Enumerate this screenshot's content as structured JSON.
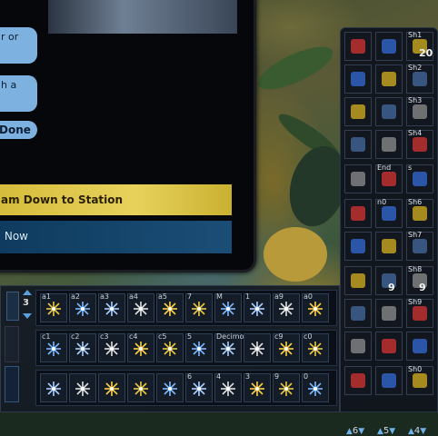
{
  "dialog": {
    "options": [
      "r or",
      "h a",
      "Done"
    ],
    "primary_action": "am Down to Station",
    "secondary_action": ": Now"
  },
  "tray": {
    "row_labels": [
      "3"
    ],
    "rows": [
      [
        "a1",
        "a2",
        "a3",
        "a4",
        "a5",
        "7",
        "M",
        "1",
        "a9",
        "a0"
      ],
      [
        "c1",
        "c2",
        "c3",
        "c4",
        "c5",
        "5",
        "Decimo2",
        "",
        "c9",
        "c0"
      ],
      [
        "",
        "",
        "",
        "",
        "",
        "6",
        "4",
        "3",
        "9",
        "0"
      ]
    ]
  },
  "right_bar": {
    "slot_labels": [
      "Sh1",
      "Sh2",
      "Sh3",
      "Sh4",
      "End",
      "s",
      "n0",
      "Sh6",
      "Sh7",
      "Sh8",
      "Sh9",
      "Sh0"
    ],
    "counts": [
      "20",
      "9",
      "9"
    ],
    "footer": [
      "6",
      "5",
      "4"
    ]
  }
}
